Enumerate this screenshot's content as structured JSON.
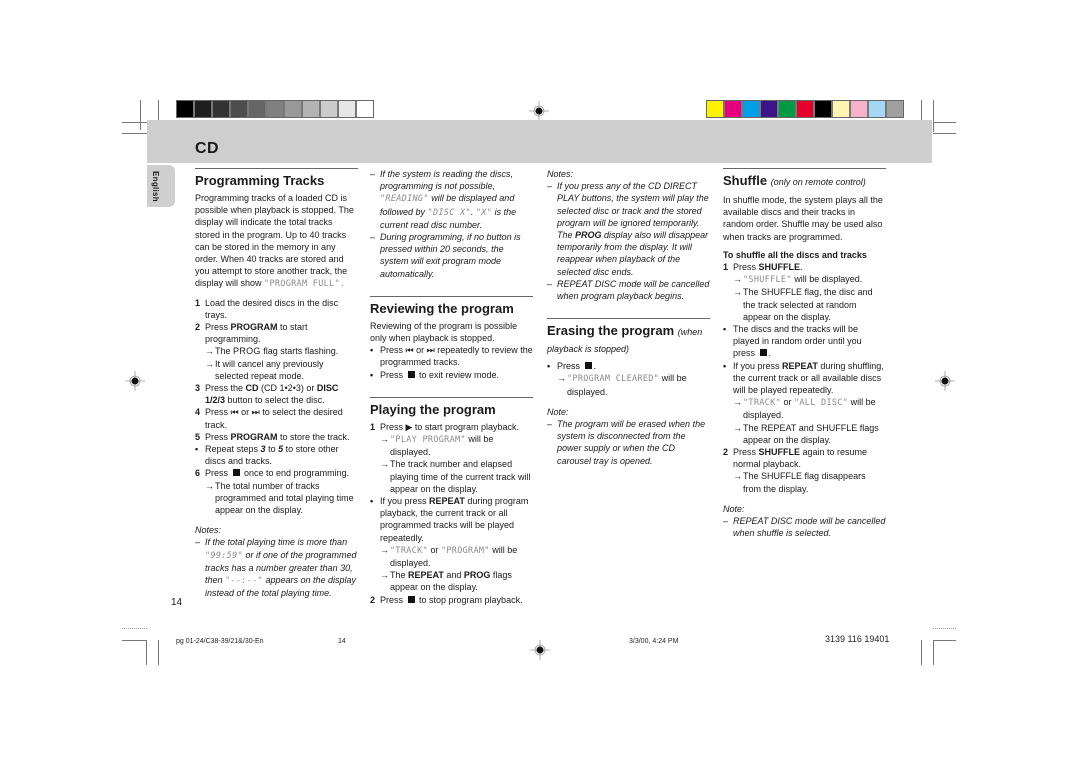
{
  "color_bar": {
    "grayscale": [
      "#000000",
      "#1e1e1e",
      "#333333",
      "#4d4d4d",
      "#666666",
      "#808080",
      "#999999",
      "#b3b3b3",
      "#cccccc",
      "#e6e6e6",
      "#ffffff"
    ],
    "process": [
      "#fff200",
      "#e6007e",
      "#00a0e9",
      "#3c1487",
      "#009a44",
      "#e4002b",
      "#000000",
      "#fff5b1",
      "#f6b2cb",
      "#a5d8f5",
      "#a0a0a0"
    ]
  },
  "header": {
    "title": "CD",
    "band_color": "#cecece"
  },
  "language_tab": "English",
  "col1": {
    "title": "Programming Tracks",
    "intro": "Programming tracks of a loaded CD is possible when playback is stopped. The display will indicate the total tracks stored in the program. Up to 40 tracks can be stored in the memory in any order. When 40 tracks are stored and you attempt to store another track, the display will show",
    "intro_lcd": "\"PROGRAM FULL\".",
    "steps": {
      "s1_num": "1",
      "s1": "Load the desired discs in the disc trays.",
      "s2_num": "2",
      "s2_pre": "Press ",
      "s2_bold": "PROGRAM",
      "s2_post": " to start programming.",
      "s2_r1_pre": "The ",
      "s2_r1_bold": "PROG",
      "s2_r1_post": " flag starts flashing.",
      "s2_r2": "It will cancel any previously selected repeat mode.",
      "s3_num": "3",
      "s3_pre": "Press the ",
      "s3_bold1": "CD",
      "s3_mid": " (CD 1•2•3) or ",
      "s3_bold2": "DISC 1/2/3",
      "s3_post": " button to select the disc.",
      "s4_num": "4",
      "s4": "Press ⏮ or ⏭ to select the desired track.",
      "s5_num": "5",
      "s5_pre": "Press ",
      "s5_bold": "PROGRAM",
      "s5_post": " to store the track.",
      "bullet_pre": "Repeat steps ",
      "bullet_b1": "3",
      "bullet_mid": " to ",
      "bullet_b2": "5",
      "bullet_post": " to store other discs and tracks.",
      "s6_num": "6",
      "s6_pre": "Press ",
      "s6_post": " once to end programming.",
      "s6_r1": "The total number of tracks programmed and total playing time appear on the display."
    },
    "notes_label": "Notes:",
    "note1_pre": "If the total playing time is more than ",
    "note1_lcd1": "\"99:59\"",
    "note1_mid": " or if one of the programmed tracks has a number greater than 30, then ",
    "note1_lcd2": "\"--:--\"",
    "note1_post": " appears on the display instead of the total playing time."
  },
  "col2": {
    "note_a_pre": "If the system is reading the discs, programming is not possible, ",
    "note_a_lcd1": "\"READING\"",
    "note_a_mid": " will be displayed and followed by ",
    "note_a_lcd2": "\"DISC X\"",
    "note_a_mid2": ". ",
    "note_a_lcd3": "\"X\"",
    "note_a_post": " is the current read disc number.",
    "note_b": "During programming,  if no button is pressed within 20 seconds, the system will exit program mode automatically.",
    "review_title": "Reviewing the program",
    "review_intro": "Reviewing of the program is possible only when playback is stopped.",
    "review_b1": "Press ⏮ or ⏭ repeatedly to review the programmed tracks.",
    "review_b2_pre": "Press ",
    "review_b2_post": " to exit review mode.",
    "play_title": "Playing the program",
    "play_s1_num": "1",
    "play_s1": "Press ▶ to start program playback.",
    "play_s1_r1_lcd": "\"PLAY PROGRAM\"",
    "play_s1_r1_post": " will be displayed.",
    "play_s1_r2": "The track number and elapsed playing time of the current track will appear on the display.",
    "play_b_pre": "If you press ",
    "play_b_bold": "REPEAT",
    "play_b_post": " during program playback, the current track or all programmed tracks will be played repeatedly.",
    "play_b_r1_lcd1": "\"TRACK\"",
    "play_b_r1_mid": " or ",
    "play_b_r1_lcd2": "\"PROGRAM\"",
    "play_b_r1_post": " will be displayed.",
    "play_b_r2_pre": "The ",
    "play_b_r2_b1": "REPEAT",
    "play_b_r2_mid": " and ",
    "play_b_r2_b2": "PROG",
    "play_b_r2_post": " flags appear on the display.",
    "play_s2_num": "2",
    "play_s2_pre": "Press ",
    "play_s2_post": " to stop program playback."
  },
  "col3": {
    "notes_label": "Notes:",
    "note1": "If you press any of the CD DIRECT PLAY buttons, the system will play the selected disc or track and the stored program will be ignored temporarily. The ",
    "note1_bold": "PROG",
    "note1_post": " display also will disappear temporarily from the display. It will reappear when playback of the selected disc ends.",
    "note2": "REPEAT DISC mode will be cancelled when program playback begins.",
    "erase_title": "Erasing the program",
    "erase_sub": "(when playback is stopped)",
    "erase_b_pre": "Press ",
    "erase_b_post": ".",
    "erase_r_lcd": "\"PROGRAM CLEARED\"",
    "erase_r_post": " will be displayed.",
    "note_label": "Note:",
    "note3": "The program will be erased when the system is disconnected from the power supply or when the CD carousel tray is opened."
  },
  "col4": {
    "title": "Shuffle",
    "title_sub": "(only on remote control)",
    "intro": "In shuffle mode, the system plays all the available discs and their tracks in random order. Shuffle may be used also when tracks are programmed.",
    "subhead": "To shuffle all the discs and tracks",
    "s1_num": "1",
    "s1_pre": "Press ",
    "s1_bold": "SHUFFLE",
    "s1_post": ".",
    "s1_r1_lcd": "\"SHUFFLE\"",
    "s1_r1_post": " will be displayed.",
    "s1_r2_pre": "The ",
    "s1_r2_bold": "SHUFFLE",
    "s1_r2_post": " flag, the disc and the track selected at random appear on the display.",
    "b1_pre": "The discs and the tracks will be played in random order until you press ",
    "b1_post": ".",
    "b2_pre": "If you press ",
    "b2_bold": "REPEAT",
    "b2_post": " during shuffling, the current track or all available discs will be played repeatedly.",
    "b2_r1_lcd1": "\"TRACK\"",
    "b2_r1_mid": " or ",
    "b2_r1_lcd2": "\"ALL DISC\"",
    "b2_r1_post": " will be displayed.",
    "b2_r2_pre": "The ",
    "b2_r2_b1": "REPEAT",
    "b2_r2_mid": " and ",
    "b2_r2_b2": "SHUFFLE",
    "b2_r2_post": " flags appear on the display.",
    "s2_num": "2",
    "s2_pre": "Press ",
    "s2_bold": "SHUFFLE",
    "s2_post": " again to resume normal playback.",
    "s2_r1_pre": "The ",
    "s2_r1_bold": "SHUFFLE",
    "s2_r1_post": " flag disappears from the display.",
    "note_label": "Note:",
    "note": "REPEAT DISC mode will be cancelled when shuffle is selected."
  },
  "page_number": "14",
  "footer": {
    "file": "pg 01-24/C38-39/21&/30-En",
    "page": "14",
    "timestamp": "3/3/00, 4:24 PM",
    "code": "3139 116 19401"
  }
}
